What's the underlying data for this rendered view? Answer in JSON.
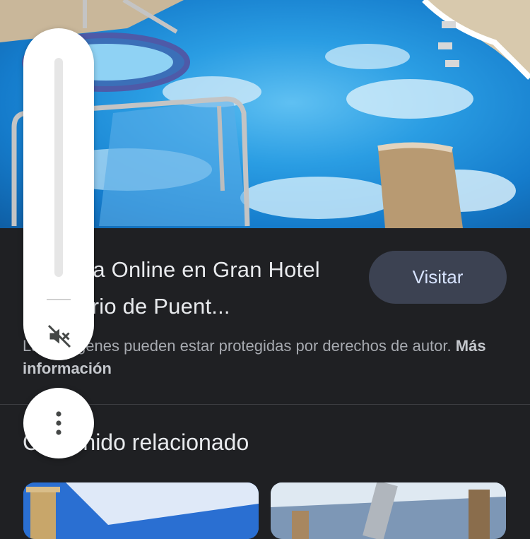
{
  "hero": {
    "image": "spa-pool-photo"
  },
  "result": {
    "title": "Reserva Online en Gran Hotel Balneario de Puent...",
    "visit_label": "Visitar",
    "copyright_text": "Las imágenes pueden estar protegidas por derechos de autor.",
    "more_info_label": "Más información"
  },
  "related": {
    "title": "Contenido relacionado",
    "items": [
      {
        "image": "spa-interior-photo"
      },
      {
        "image": "spa-jet-photo"
      }
    ]
  },
  "volume": {
    "level": 0,
    "muted": true,
    "icon": "volume-off-icon"
  },
  "overflow": {
    "icon": "more-vert-icon"
  },
  "colors": {
    "background": "#1f2023",
    "button": "#3c4252",
    "button_text": "#d7e3ff",
    "panel": "#ffffff"
  }
}
